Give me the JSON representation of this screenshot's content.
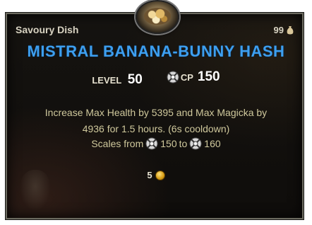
{
  "item": {
    "subtype": "Savoury Dish",
    "value": "99",
    "name": "MISTRAL BANANA-BUNNY HASH",
    "level_label": "LEVEL",
    "level_value": "50",
    "cp_label": "CP",
    "cp_value": "150",
    "description_line1": "Increase Max Health by 5395 and Max Magicka by",
    "description_line2": "4936 for 1.5 hours. (6s cooldown)",
    "scales_prefix": "Scales from",
    "scales_from": "150",
    "scales_to_word": "to",
    "scales_to": "160",
    "count": "5"
  },
  "colors": {
    "title": "#3d9ff0",
    "description": "#cfc89c",
    "border": "#6b6a5f"
  },
  "icons": [
    "food-icon",
    "bag-icon",
    "champion-point-icon",
    "gold-icon"
  ]
}
